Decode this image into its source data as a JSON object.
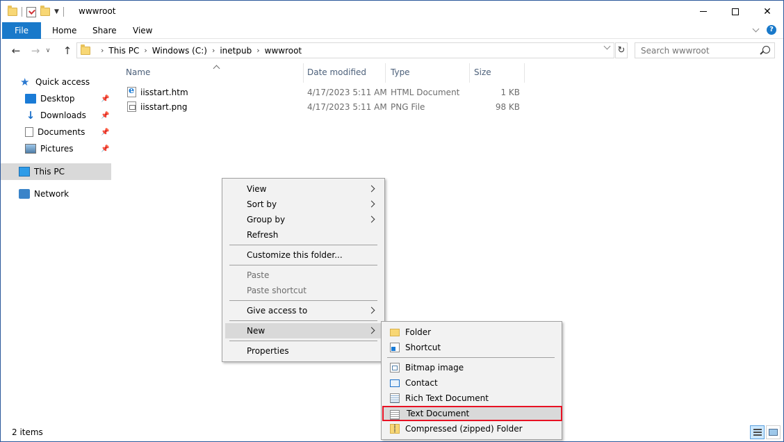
{
  "window": {
    "title": "wwwroot"
  },
  "ribbon": {
    "tabs": [
      "File",
      "Home",
      "Share",
      "View"
    ]
  },
  "address": {
    "crumbs": [
      "This PC",
      "Windows (C:)",
      "inetpub",
      "wwwroot"
    ],
    "search_placeholder": "Search wwwroot"
  },
  "navpane": {
    "quick_access": "Quick access",
    "items": [
      "Desktop",
      "Downloads",
      "Documents",
      "Pictures"
    ],
    "this_pc": "This PC",
    "network": "Network"
  },
  "filelist": {
    "headers": [
      "Name",
      "Date modified",
      "Type",
      "Size"
    ],
    "files": [
      {
        "name": "iisstart.htm",
        "date": "4/17/2023 5:11 AM",
        "type": "HTML Document",
        "size": "1 KB",
        "icon": "ie-html-icon"
      },
      {
        "name": "iisstart.png",
        "date": "4/17/2023 5:11 AM",
        "type": "PNG File",
        "size": "98 KB",
        "icon": "png-file-icon"
      }
    ]
  },
  "status": {
    "count": "2 items"
  },
  "context_menu": {
    "items": [
      "View",
      "Sort by",
      "Group by",
      "Refresh",
      "Customize this folder...",
      "Paste",
      "Paste shortcut",
      "Give access to",
      "New",
      "Properties"
    ]
  },
  "new_submenu": {
    "items": [
      "Folder",
      "Shortcut",
      "Bitmap image",
      "Contact",
      "Rich Text Document",
      "Text Document",
      "Compressed (zipped) Folder"
    ],
    "highlight_color": "#e81123"
  }
}
